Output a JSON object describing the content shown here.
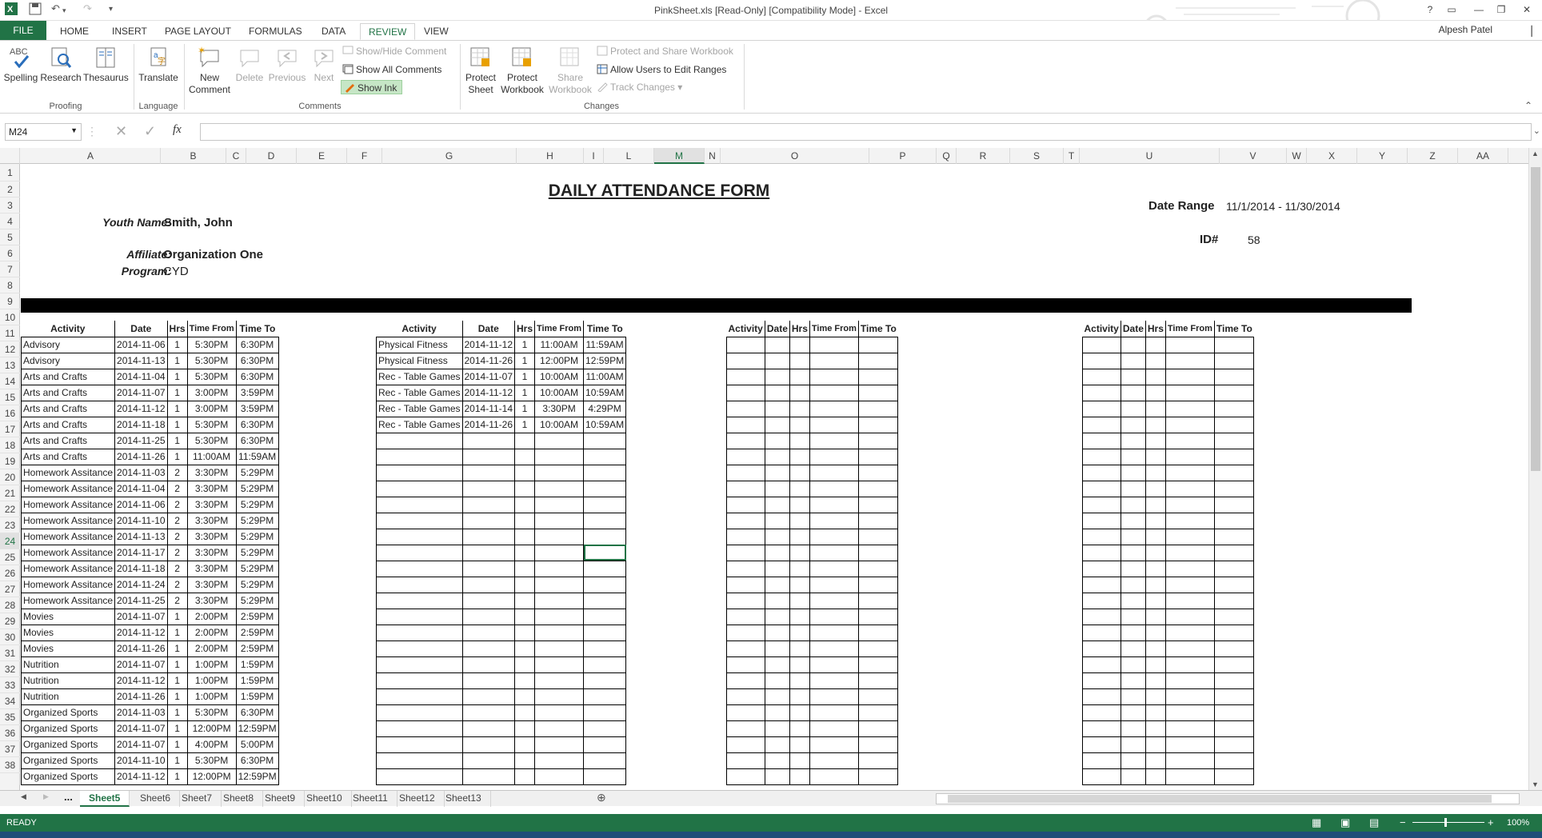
{
  "window": {
    "title": "PinkSheet.xls  [Read-Only]  [Compatibility Mode] - Excel",
    "user": "Alpesh Patel",
    "help": "?",
    "minimize": "—",
    "restore": "❐",
    "close": "✕"
  },
  "ribbon_tabs": [
    "FILE",
    "HOME",
    "INSERT",
    "PAGE LAYOUT",
    "FORMULAS",
    "DATA",
    "REVIEW",
    "VIEW"
  ],
  "ribbon": {
    "proofing": {
      "label": "Proofing",
      "spelling": "Spelling",
      "research": "Research",
      "thesaurus": "Thesaurus"
    },
    "language": {
      "label": "Language",
      "translate": "Translate"
    },
    "comments": {
      "label": "Comments",
      "new_comment_1": "New",
      "new_comment_2": "Comment",
      "delete": "Delete",
      "previous": "Previous",
      "next": "Next",
      "show_hide": "Show/Hide Comment",
      "show_all": "Show All Comments",
      "show_ink": "Show Ink"
    },
    "changes": {
      "label": "Changes",
      "protect_sheet_1": "Protect",
      "protect_sheet_2": "Sheet",
      "protect_workbook_1": "Protect",
      "protect_workbook_2": "Workbook",
      "share_workbook_1": "Share",
      "share_workbook_2": "Workbook",
      "protect_share": "Protect and Share Workbook",
      "allow_users": "Allow Users to Edit Ranges",
      "track_changes": "Track Changes"
    }
  },
  "formula_bar": {
    "name_box": "M24",
    "fx": "fx",
    "value": ""
  },
  "columns": [
    "A",
    "B",
    "C",
    "D",
    "E",
    "F",
    "G",
    "H",
    "I",
    "L",
    "M",
    "N",
    "O",
    "P",
    "Q",
    "R",
    "S",
    "T",
    "U",
    "V",
    "W",
    "X",
    "Y",
    "Z",
    "AA"
  ],
  "selected_column": "M",
  "rows": [
    "1",
    "2",
    "3",
    "4",
    "5",
    "6",
    "7",
    "8",
    "9",
    "10",
    "11",
    "12",
    "13",
    "14",
    "15",
    "16",
    "17",
    "18",
    "19",
    "20",
    "21",
    "22",
    "23",
    "24",
    "25",
    "26",
    "27",
    "28",
    "29",
    "30",
    "31",
    "32",
    "33",
    "34",
    "35",
    "36",
    "37",
    "38"
  ],
  "selected_row": "24",
  "form": {
    "title": "DAILY ATTENDANCE FORM",
    "date_range_label": "Date Range",
    "date_range_value": "11/1/2014 - 11/30/2014",
    "youth_name_label": "Youth Name:",
    "youth_name_value": "Smith, John",
    "id_label": "ID#",
    "id_value": "58",
    "affiliate_label": "Affiliate:",
    "affiliate_value": "Organization One",
    "program_label": "Program:",
    "program_value": "CYD"
  },
  "table_headers": [
    "Activity",
    "Date",
    "Hrs",
    "Time From",
    "Time To"
  ],
  "table1": [
    [
      "Advisory",
      "2014-11-06",
      "1",
      "5:30PM",
      "6:30PM"
    ],
    [
      "Advisory",
      "2014-11-13",
      "1",
      "5:30PM",
      "6:30PM"
    ],
    [
      "Arts and Crafts",
      "2014-11-04",
      "1",
      "5:30PM",
      "6:30PM"
    ],
    [
      "Arts and Crafts",
      "2014-11-07",
      "1",
      "3:00PM",
      "3:59PM"
    ],
    [
      "Arts and Crafts",
      "2014-11-12",
      "1",
      "3:00PM",
      "3:59PM"
    ],
    [
      "Arts and Crafts",
      "2014-11-18",
      "1",
      "5:30PM",
      "6:30PM"
    ],
    [
      "Arts and Crafts",
      "2014-11-25",
      "1",
      "5:30PM",
      "6:30PM"
    ],
    [
      "Arts and Crafts",
      "2014-11-26",
      "1",
      "11:00AM",
      "11:59AM"
    ],
    [
      "Homework Assitance",
      "2014-11-03",
      "2",
      "3:30PM",
      "5:29PM"
    ],
    [
      "Homework Assitance",
      "2014-11-04",
      "2",
      "3:30PM",
      "5:29PM"
    ],
    [
      "Homework Assitance",
      "2014-11-06",
      "2",
      "3:30PM",
      "5:29PM"
    ],
    [
      "Homework Assitance",
      "2014-11-10",
      "2",
      "3:30PM",
      "5:29PM"
    ],
    [
      "Homework Assitance",
      "2014-11-13",
      "2",
      "3:30PM",
      "5:29PM"
    ],
    [
      "Homework Assitance",
      "2014-11-17",
      "2",
      "3:30PM",
      "5:29PM"
    ],
    [
      "Homework Assitance",
      "2014-11-18",
      "2",
      "3:30PM",
      "5:29PM"
    ],
    [
      "Homework Assitance",
      "2014-11-24",
      "2",
      "3:30PM",
      "5:29PM"
    ],
    [
      "Homework Assitance",
      "2014-11-25",
      "2",
      "3:30PM",
      "5:29PM"
    ],
    [
      "Movies",
      "2014-11-07",
      "1",
      "2:00PM",
      "2:59PM"
    ],
    [
      "Movies",
      "2014-11-12",
      "1",
      "2:00PM",
      "2:59PM"
    ],
    [
      "Movies",
      "2014-11-26",
      "1",
      "2:00PM",
      "2:59PM"
    ],
    [
      "Nutrition",
      "2014-11-07",
      "1",
      "1:00PM",
      "1:59PM"
    ],
    [
      "Nutrition",
      "2014-11-12",
      "1",
      "1:00PM",
      "1:59PM"
    ],
    [
      "Nutrition",
      "2014-11-26",
      "1",
      "1:00PM",
      "1:59PM"
    ],
    [
      "Organized Sports",
      "2014-11-03",
      "1",
      "5:30PM",
      "6:30PM"
    ],
    [
      "Organized Sports",
      "2014-11-07",
      "1",
      "12:00PM",
      "12:59PM"
    ],
    [
      "Organized Sports",
      "2014-11-07",
      "1",
      "4:00PM",
      "5:00PM"
    ],
    [
      "Organized Sports",
      "2014-11-10",
      "1",
      "5:30PM",
      "6:30PM"
    ],
    [
      "Organized Sports",
      "2014-11-12",
      "1",
      "12:00PM",
      "12:59PM"
    ]
  ],
  "table2": [
    [
      "Physical Fitness",
      "2014-11-12",
      "1",
      "11:00AM",
      "11:59AM"
    ],
    [
      "Physical Fitness",
      "2014-11-26",
      "1",
      "12:00PM",
      "12:59PM"
    ],
    [
      "Rec - Table Games",
      "2014-11-07",
      "1",
      "10:00AM",
      "11:00AM"
    ],
    [
      "Rec - Table Games",
      "2014-11-12",
      "1",
      "10:00AM",
      "10:59AM"
    ],
    [
      "Rec - Table Games",
      "2014-11-14",
      "1",
      "3:30PM",
      "4:29PM"
    ],
    [
      "Rec - Table Games",
      "2014-11-26",
      "1",
      "10:00AM",
      "10:59AM"
    ]
  ],
  "sheet_tabs": [
    "Sheet5",
    "Sheet6",
    "Sheet7",
    "Sheet8",
    "Sheet9",
    "Sheet10",
    "Sheet11",
    "Sheet12",
    "Sheet13"
  ],
  "sheet_nav_more": "...",
  "active_sheet": "Sheet5",
  "status": {
    "mode": "READY",
    "zoom": "100%"
  }
}
